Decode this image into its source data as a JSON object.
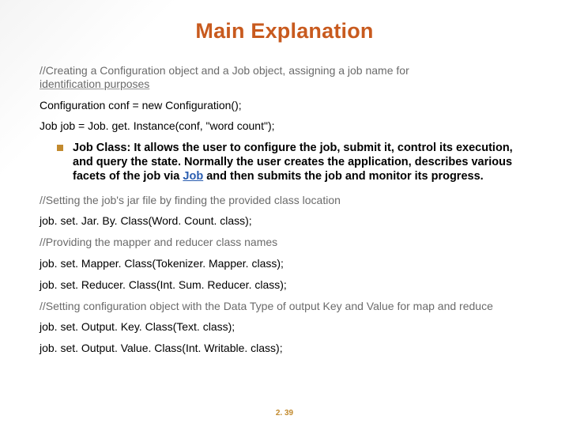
{
  "title": "Main Explanation",
  "lines": {
    "c1a": "//Creating a Configuration object and a Job object, assigning a job name for",
    "c1b": "identification purposes",
    "l1": "Configuration conf = new Configuration();",
    "l2": "Job job = Job. get. Instance(conf, \"word count\");",
    "bullet_pre": "Job Class: It allows the user to configure the job, submit it, control its execution, and query the state. Normally the user creates the application, describes various facets of the job via ",
    "bullet_link": "Job",
    "bullet_post": " and then submits the job and monitor its progress.",
    "c2": "//Setting the job's jar file by finding the provided class location",
    "l3": "job. set. Jar. By. Class(Word. Count. class);",
    "c3": "//Providing the mapper and reducer class names",
    "l4": "job. set. Mapper. Class(Tokenizer. Mapper. class);",
    "l5": "job. set. Reducer. Class(Int. Sum. Reducer. class);",
    "c4": "//Setting configuration object with the Data Type of output Key and Value for map and reduce",
    "l6": "job. set. Output. Key. Class(Text. class);",
    "l7": "job. set. Output. Value. Class(Int. Writable. class);"
  },
  "slide_number": "2. 39"
}
